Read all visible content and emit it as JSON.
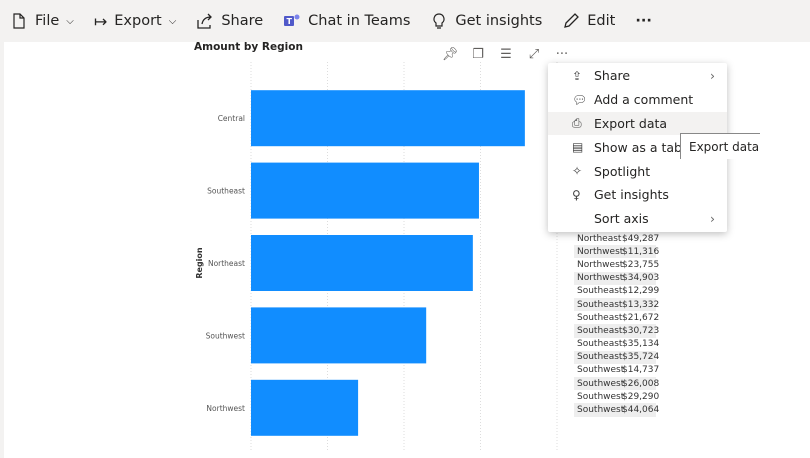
{
  "toolbar": {
    "file": "File",
    "export": "Export",
    "share": "Share",
    "chat": "Chat in Teams",
    "insights": "Get insights",
    "edit": "Edit",
    "more": "···"
  },
  "visual": {
    "title": "Amount by Region"
  },
  "chart_data": {
    "type": "bar",
    "orientation": "horizontal",
    "title": "Amount by Region",
    "ylabel": "Region",
    "xlabel": "",
    "categories": [
      "Central",
      "Southeast",
      "Northeast",
      "Southwest",
      "Northwest"
    ],
    "values": [
      3.58,
      2.98,
      2.9,
      2.29,
      1.4
    ],
    "value_units": "gridline intervals (axis labels not visible)",
    "xlim": [
      0,
      4
    ],
    "grid": true,
    "color": "#118dff"
  },
  "menu": [
    {
      "icon": "share-icon",
      "label": "Share",
      "submenu": true
    },
    {
      "icon": "comment-icon",
      "label": "Add a comment"
    },
    {
      "icon": "export-data-icon",
      "label": "Export data",
      "highlight": true
    },
    {
      "icon": "table-icon",
      "label": "Show as a table"
    },
    {
      "icon": "spotlight-icon",
      "label": "Spotlight"
    },
    {
      "icon": "lightbulb-icon",
      "label": "Get insights"
    },
    {
      "icon": "",
      "label": "Sort axis",
      "submenu": true
    }
  ],
  "tooltip": "Export data",
  "table_rows": [
    [
      "Northeast",
      "$49,287"
    ],
    [
      "Northwest",
      "$11,316"
    ],
    [
      "Northwest",
      "$23,755"
    ],
    [
      "Northwest",
      "$34,903"
    ],
    [
      "Southeast",
      "$12,299"
    ],
    [
      "Southeast",
      "$13,332"
    ],
    [
      "Southeast",
      "$21,672"
    ],
    [
      "Southeast",
      "$30,723"
    ],
    [
      "Southeast",
      "$35,134"
    ],
    [
      "Southeast",
      "$35,724"
    ],
    [
      "Southwest",
      "$14,737"
    ],
    [
      "Southwest",
      "$26,008"
    ],
    [
      "Southwest",
      "$29,290"
    ],
    [
      "Southwest",
      "$44,064"
    ]
  ]
}
